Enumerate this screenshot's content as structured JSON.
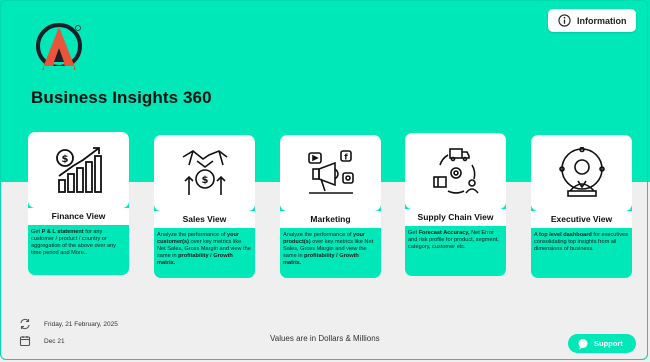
{
  "header": {
    "title": "Business Insights 360",
    "info_button": "Information"
  },
  "cards": [
    {
      "title": "Finance View",
      "icon": "finance-chart-icon",
      "desc_parts": [
        {
          "t": "Get ",
          "b": false
        },
        {
          "t": "P & L statement",
          "b": true
        },
        {
          "t": " for any customer / product / country or aggregation of the above over any time period and More..",
          "b": false
        }
      ]
    },
    {
      "title": "Sales View",
      "icon": "sales-handshake-icon",
      "desc_parts": [
        {
          "t": "Analyze the performance of ",
          "b": false
        },
        {
          "t": "your customer(s)",
          "b": true
        },
        {
          "t": " over key metrics like Net Sales, Gross Margin and view the same in ",
          "b": false
        },
        {
          "t": "profitability / Growth matrix.",
          "b": true
        }
      ]
    },
    {
      "title": "Marketing",
      "icon": "marketing-megaphone-icon",
      "desc_parts": [
        {
          "t": "Analyze the performance of ",
          "b": false
        },
        {
          "t": "your product(s)",
          "b": true
        },
        {
          "t": " over key metrics like Net Sales, Gross Margin and view the same in ",
          "b": false
        },
        {
          "t": "profitability / Growth matrix.",
          "b": true
        }
      ]
    },
    {
      "title": "Supply Chain View",
      "icon": "supply-chain-icon",
      "desc_parts": [
        {
          "t": "Get ",
          "b": false
        },
        {
          "t": "Forecast Accuracy,",
          "b": true
        },
        {
          "t": " Net Error and risk profile for product, segment, category, customer etc.",
          "b": false
        }
      ]
    },
    {
      "title": "Executive View",
      "icon": "executive-person-icon",
      "desc_parts": [
        {
          "t": "A ",
          "b": false
        },
        {
          "t": "top level dashboard",
          "b": true
        },
        {
          "t": " for executives consolidating top insights from all dimensions of business.",
          "b": false
        }
      ]
    }
  ],
  "footer": {
    "refresh_date": "Friday, 21 February, 2025",
    "period": "Dec 21",
    "values_note": "Values are in Dollars & Millions",
    "support_button": "Support"
  },
  "colors": {
    "accent": "#00e8b8",
    "background": "#efefef"
  }
}
